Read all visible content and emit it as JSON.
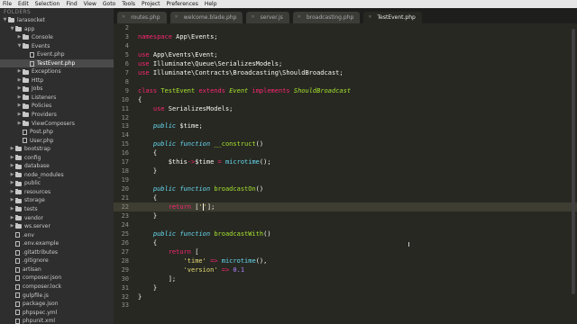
{
  "menu": [
    "File",
    "Edit",
    "Selection",
    "Find",
    "View",
    "Goto",
    "Tools",
    "Project",
    "Preferences",
    "Help"
  ],
  "sidebar": {
    "header": "FOLDERS",
    "items": [
      {
        "label": "larasocket",
        "type": "folder",
        "depth": 0,
        "open": true
      },
      {
        "label": "app",
        "type": "folder",
        "depth": 1,
        "open": true
      },
      {
        "label": "Console",
        "type": "folder",
        "depth": 2,
        "open": false
      },
      {
        "label": "Events",
        "type": "folder",
        "depth": 2,
        "open": true
      },
      {
        "label": "Event.php",
        "type": "file",
        "depth": 3
      },
      {
        "label": "TestEvent.php",
        "type": "file",
        "depth": 3,
        "selected": true
      },
      {
        "label": "Exceptions",
        "type": "folder",
        "depth": 2,
        "open": false
      },
      {
        "label": "Http",
        "type": "folder",
        "depth": 2,
        "open": false
      },
      {
        "label": "Jobs",
        "type": "folder",
        "depth": 2,
        "open": false
      },
      {
        "label": "Listeners",
        "type": "folder",
        "depth": 2,
        "open": false
      },
      {
        "label": "Policies",
        "type": "folder",
        "depth": 2,
        "open": false
      },
      {
        "label": "Providers",
        "type": "folder",
        "depth": 2,
        "open": false
      },
      {
        "label": "ViewComposers",
        "type": "folder",
        "depth": 2,
        "open": false
      },
      {
        "label": "Post.php",
        "type": "file",
        "depth": 2
      },
      {
        "label": "User.php",
        "type": "file",
        "depth": 2
      },
      {
        "label": "bootstrap",
        "type": "folder",
        "depth": 1,
        "open": false
      },
      {
        "label": "config",
        "type": "folder",
        "depth": 1,
        "open": false
      },
      {
        "label": "database",
        "type": "folder",
        "depth": 1,
        "open": false
      },
      {
        "label": "node_modules",
        "type": "folder",
        "depth": 1,
        "open": false
      },
      {
        "label": "public",
        "type": "folder",
        "depth": 1,
        "open": false
      },
      {
        "label": "resources",
        "type": "folder",
        "depth": 1,
        "open": false
      },
      {
        "label": "storage",
        "type": "folder",
        "depth": 1,
        "open": false
      },
      {
        "label": "tests",
        "type": "folder",
        "depth": 1,
        "open": false
      },
      {
        "label": "vendor",
        "type": "folder",
        "depth": 1,
        "open": false
      },
      {
        "label": "ws.server",
        "type": "folder",
        "depth": 1,
        "open": false
      },
      {
        "label": ".env",
        "type": "file",
        "depth": 1
      },
      {
        "label": ".env.example",
        "type": "file",
        "depth": 1
      },
      {
        "label": ".gitattributes",
        "type": "file",
        "depth": 1
      },
      {
        "label": ".gitignore",
        "type": "file",
        "depth": 1
      },
      {
        "label": "artisan",
        "type": "file",
        "depth": 1
      },
      {
        "label": "composer.json",
        "type": "file",
        "depth": 1
      },
      {
        "label": "composer.lock",
        "type": "file",
        "depth": 1
      },
      {
        "label": "gulpfile.js",
        "type": "file",
        "depth": 1
      },
      {
        "label": "package.json",
        "type": "file",
        "depth": 1
      },
      {
        "label": "phpspec.yml",
        "type": "file",
        "depth": 1
      },
      {
        "label": "phpunit.xml",
        "type": "file",
        "depth": 1
      }
    ]
  },
  "tabs": [
    {
      "label": "routes.php",
      "active": false
    },
    {
      "label": "welcome.blade.php",
      "active": false
    },
    {
      "label": "server.js",
      "active": false
    },
    {
      "label": "broadcasting.php",
      "active": false
    },
    {
      "label": "TestEvent.php",
      "active": true
    }
  ],
  "editor": {
    "current_line": 22,
    "lines": [
      {
        "n": "2",
        "code": ""
      },
      {
        "n": "3",
        "code": "namespace App\\Events;"
      },
      {
        "n": "4",
        "code": ""
      },
      {
        "n": "5",
        "code": "use App\\Events\\Event;"
      },
      {
        "n": "6",
        "code": "use Illuminate\\Queue\\SerializesModels;"
      },
      {
        "n": "7",
        "code": "use Illuminate\\Contracts\\Broadcasting\\ShouldBroadcast;"
      },
      {
        "n": "8",
        "code": ""
      },
      {
        "n": "9",
        "code": "class TestEvent extends Event implements ShouldBroadcast"
      },
      {
        "n": "10",
        "code": "{"
      },
      {
        "n": "11",
        "code": "    use SerializesModels;"
      },
      {
        "n": "12",
        "code": ""
      },
      {
        "n": "13",
        "code": "    public $time;"
      },
      {
        "n": "14",
        "code": ""
      },
      {
        "n": "15",
        "code": "    public function __construct()"
      },
      {
        "n": "16",
        "code": "    {"
      },
      {
        "n": "17",
        "code": "        $this->$time = microtime();"
      },
      {
        "n": "18",
        "code": "    }"
      },
      {
        "n": "19",
        "code": ""
      },
      {
        "n": "20",
        "code": "    public function broadcastOn()"
      },
      {
        "n": "21",
        "code": "    {"
      },
      {
        "n": "22",
        "code": "        return ['];"
      },
      {
        "n": "23",
        "code": "    }"
      },
      {
        "n": "24",
        "code": ""
      },
      {
        "n": "25",
        "code": "    public function broadcastWith()"
      },
      {
        "n": "26",
        "code": "    {"
      },
      {
        "n": "27",
        "code": "        return ["
      },
      {
        "n": "28",
        "code": "            'time' => microtime(),"
      },
      {
        "n": "29",
        "code": "            'version' => 0.1"
      },
      {
        "n": "30",
        "code": "        ];"
      },
      {
        "n": "31",
        "code": "    }"
      },
      {
        "n": "32",
        "code": "}"
      },
      {
        "n": "33",
        "code": ""
      }
    ]
  },
  "colors": {
    "editor_bg": "#272822",
    "sidebar_bg": "#2e2e2e",
    "keyword": "#f92672",
    "storage": "#66d9ef",
    "class_name": "#a6e22e",
    "string": "#e6db74",
    "number": "#ae81ff",
    "comment": "#75715e",
    "selection": "#4a4a4a"
  },
  "icons": [
    "folder-icon",
    "file-icon",
    "disclosure-arrow-icon",
    "tab-close-icon"
  ]
}
